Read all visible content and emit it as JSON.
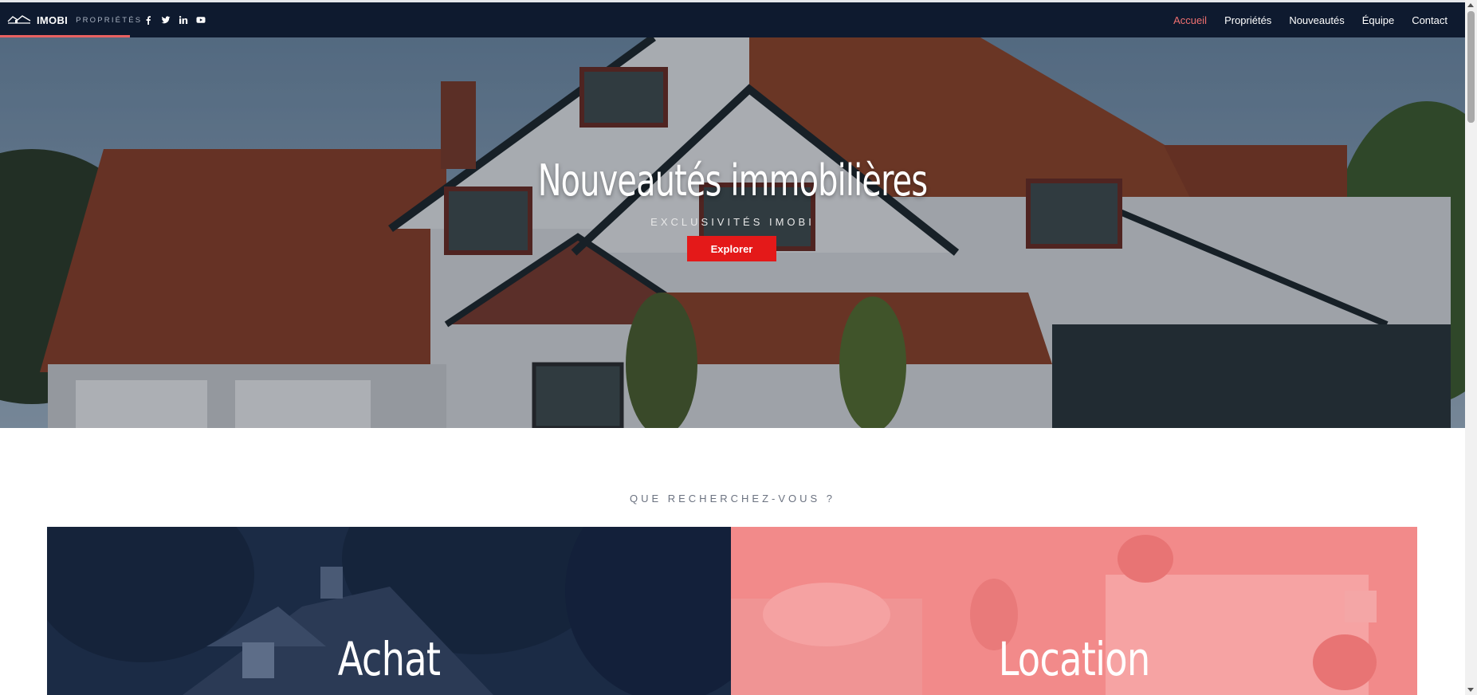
{
  "brand": {
    "name": "IMOBI",
    "tagline": "PROPRIÉTÉS"
  },
  "socials": [
    "facebook-icon",
    "twitter-icon",
    "linkedin-icon",
    "youtube-icon"
  ],
  "nav": {
    "items": [
      {
        "label": "Accueil",
        "active": true
      },
      {
        "label": "Propriétés",
        "active": false
      },
      {
        "label": "Nouveautés",
        "active": false
      },
      {
        "label": "Équipe",
        "active": false
      },
      {
        "label": "Contact",
        "active": false
      }
    ]
  },
  "hero": {
    "title": "Nouveautés immobilières",
    "subtitle": "EXCLUSIVITÉS IMOBI",
    "button": "Explorer"
  },
  "section": {
    "label": "QUE RECHERCHEZ-VOUS ?",
    "cards": [
      {
        "title": "Achat"
      },
      {
        "title": "Location"
      }
    ]
  },
  "colors": {
    "navbar": "#0e1a2f",
    "accent_red": "#e41919",
    "active_link": "#f07070",
    "achat_overlay": "#1b2b45",
    "location_overlay": "#f38686"
  }
}
